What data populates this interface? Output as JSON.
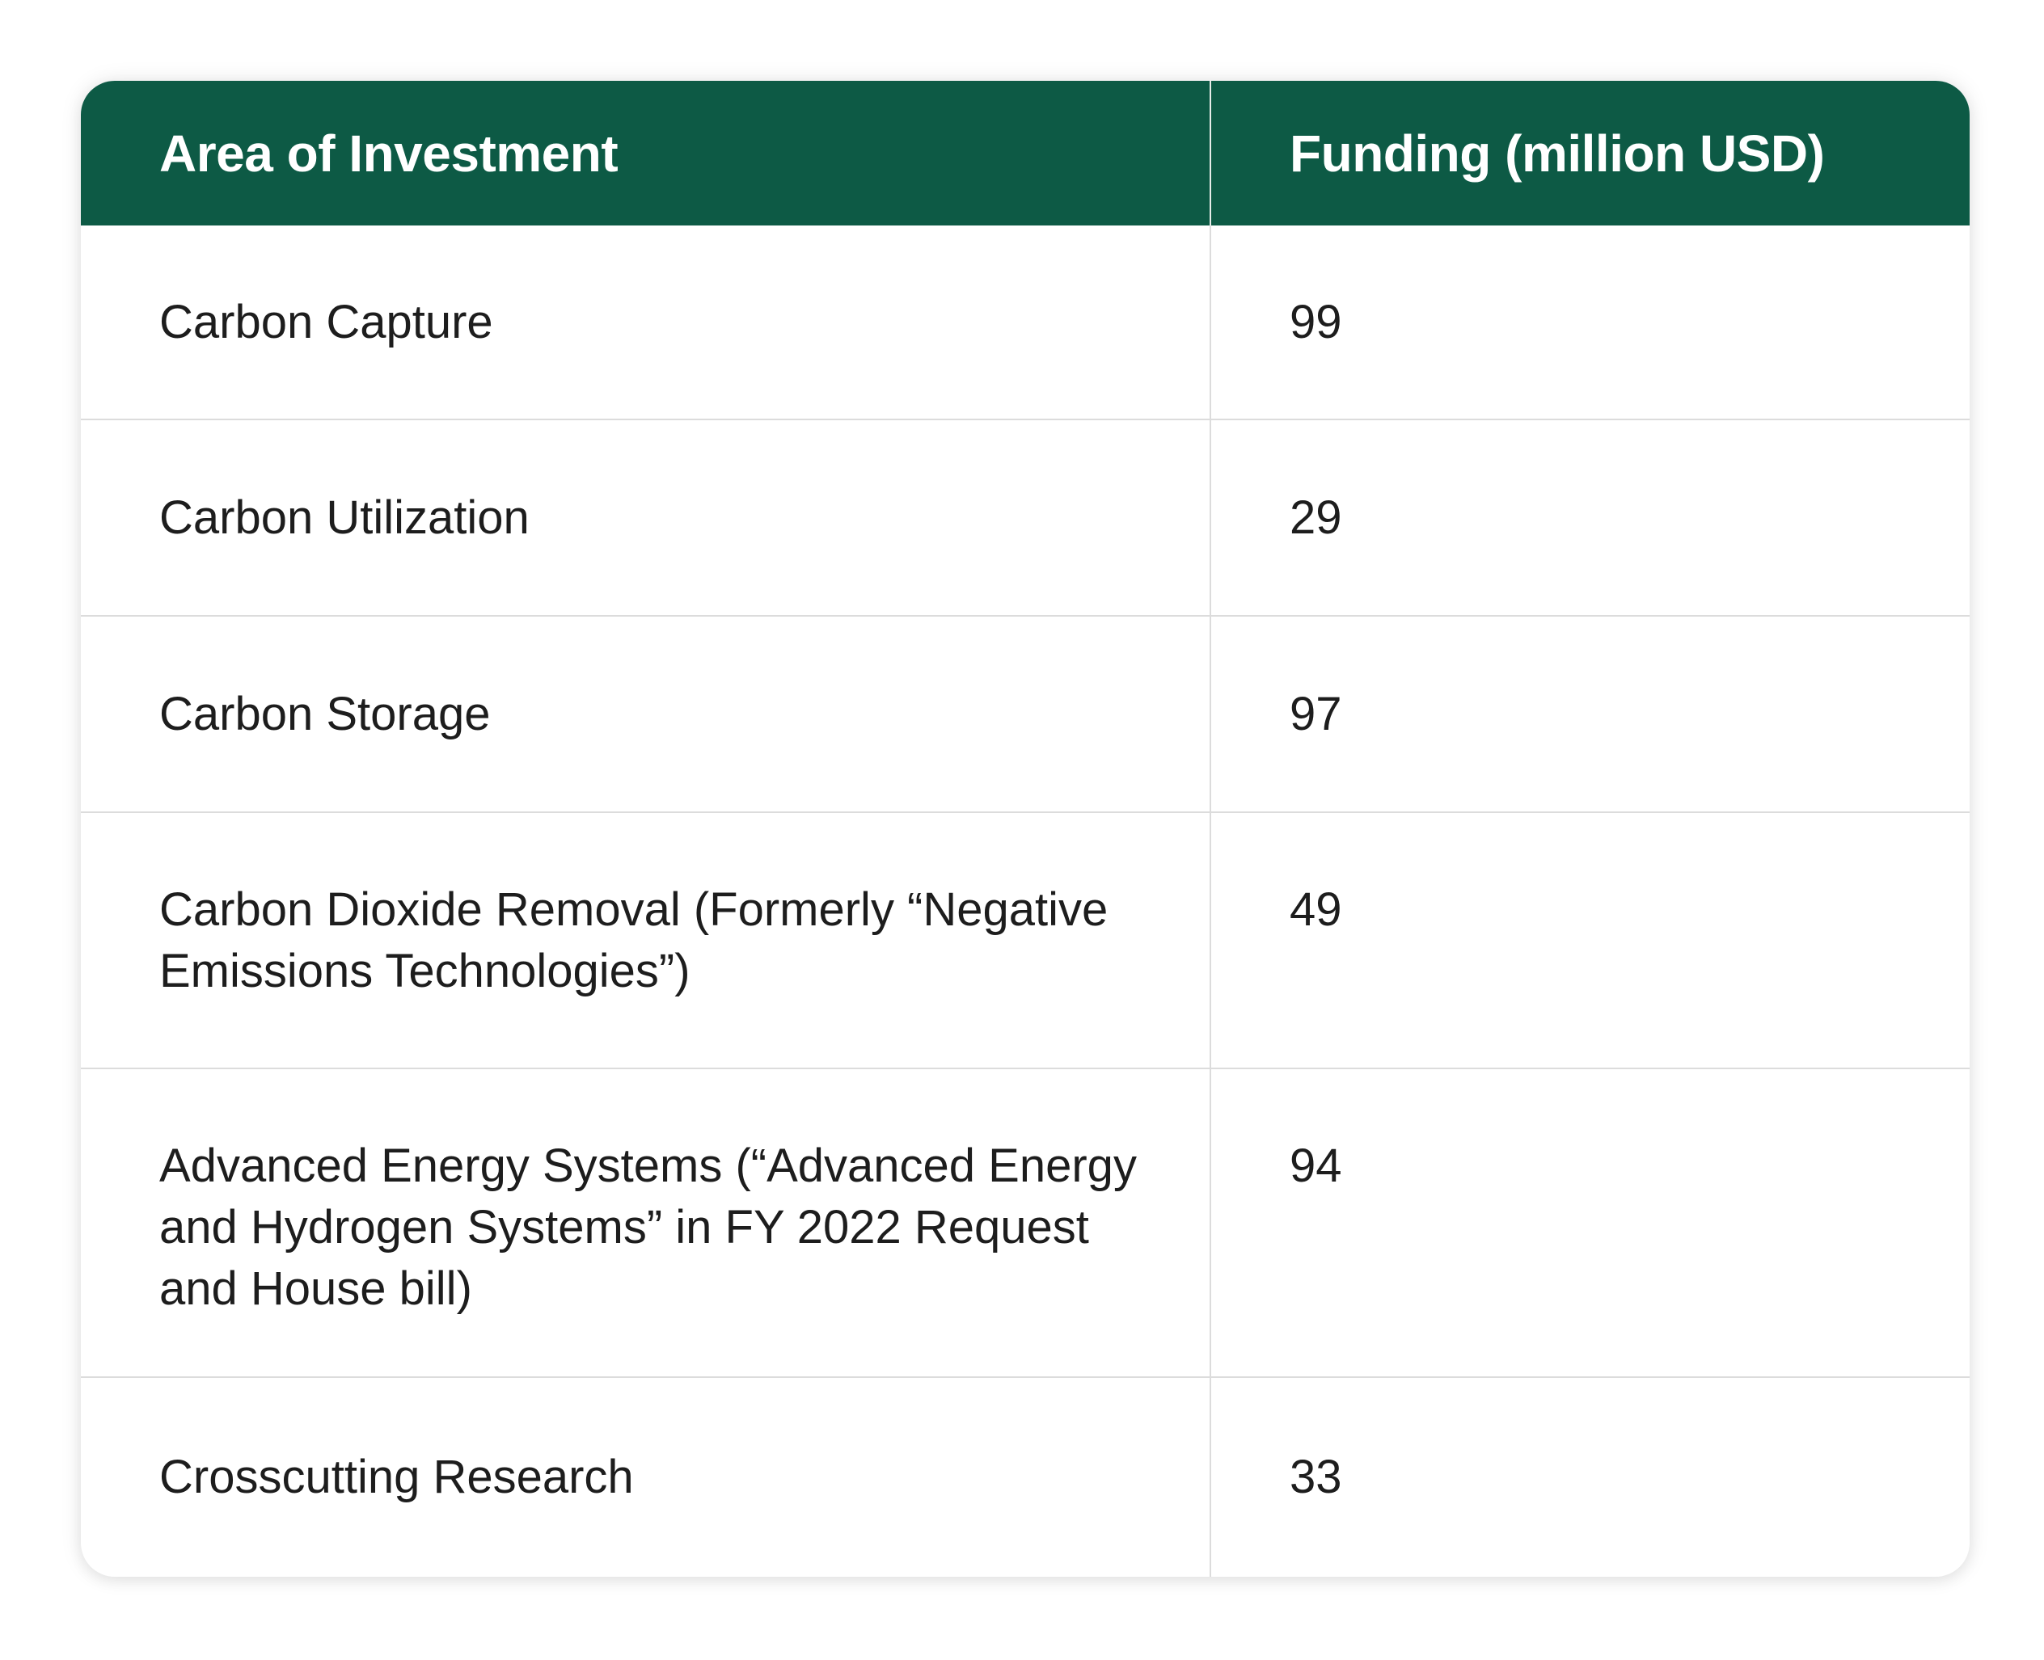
{
  "chart_data": {
    "type": "table",
    "columns": [
      "Area of Investment",
      "Funding (million USD)"
    ],
    "rows": [
      {
        "area": "Carbon Capture",
        "funding": "99"
      },
      {
        "area": "Carbon Utilization",
        "funding": "29"
      },
      {
        "area": "Carbon Storage",
        "funding": "97"
      },
      {
        "area": "Carbon Dioxide Removal (Formerly “Negative Emissions Technologies”)",
        "funding": "49"
      },
      {
        "area": "Advanced Energy Systems (“Advanced Energy and Hydrogen Systems” in FY 2022 Request and House bill)",
        "funding": "94"
      },
      {
        "area": "Crosscutting Research",
        "funding": "33"
      }
    ]
  },
  "colors": {
    "header_background": "#0d5a45",
    "header_text": "#ffffff",
    "body_text": "#1d1d1d",
    "grid_line": "#dcdcdc"
  }
}
